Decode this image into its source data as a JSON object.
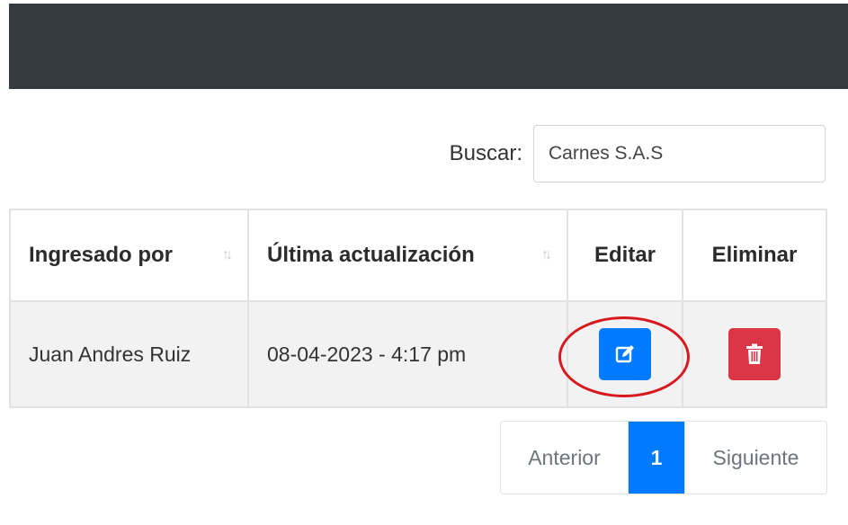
{
  "search": {
    "label": "Buscar:",
    "value": "Carnes S.A.S"
  },
  "table": {
    "columns": [
      {
        "label": "Ingresado por",
        "sortable": true
      },
      {
        "label": "Última actualización",
        "sortable": true
      },
      {
        "label": "Editar",
        "sortable": false
      },
      {
        "label": "Eliminar",
        "sortable": false
      }
    ],
    "rows": [
      {
        "ingresado_por": "Juan Andres Ruiz",
        "ultima_actualizacion": "08-04-2023 - 4:17 pm"
      }
    ]
  },
  "pagination": {
    "previous": "Anterior",
    "current": "1",
    "next": "Siguiente"
  },
  "icons": {
    "sort": "sort-arrows-icon",
    "edit": "edit-icon",
    "delete": "trash-icon"
  },
  "colors": {
    "header_bar": "#343a40",
    "primary": "#007bff",
    "danger": "#dc3545",
    "highlight": "#d7191f"
  }
}
